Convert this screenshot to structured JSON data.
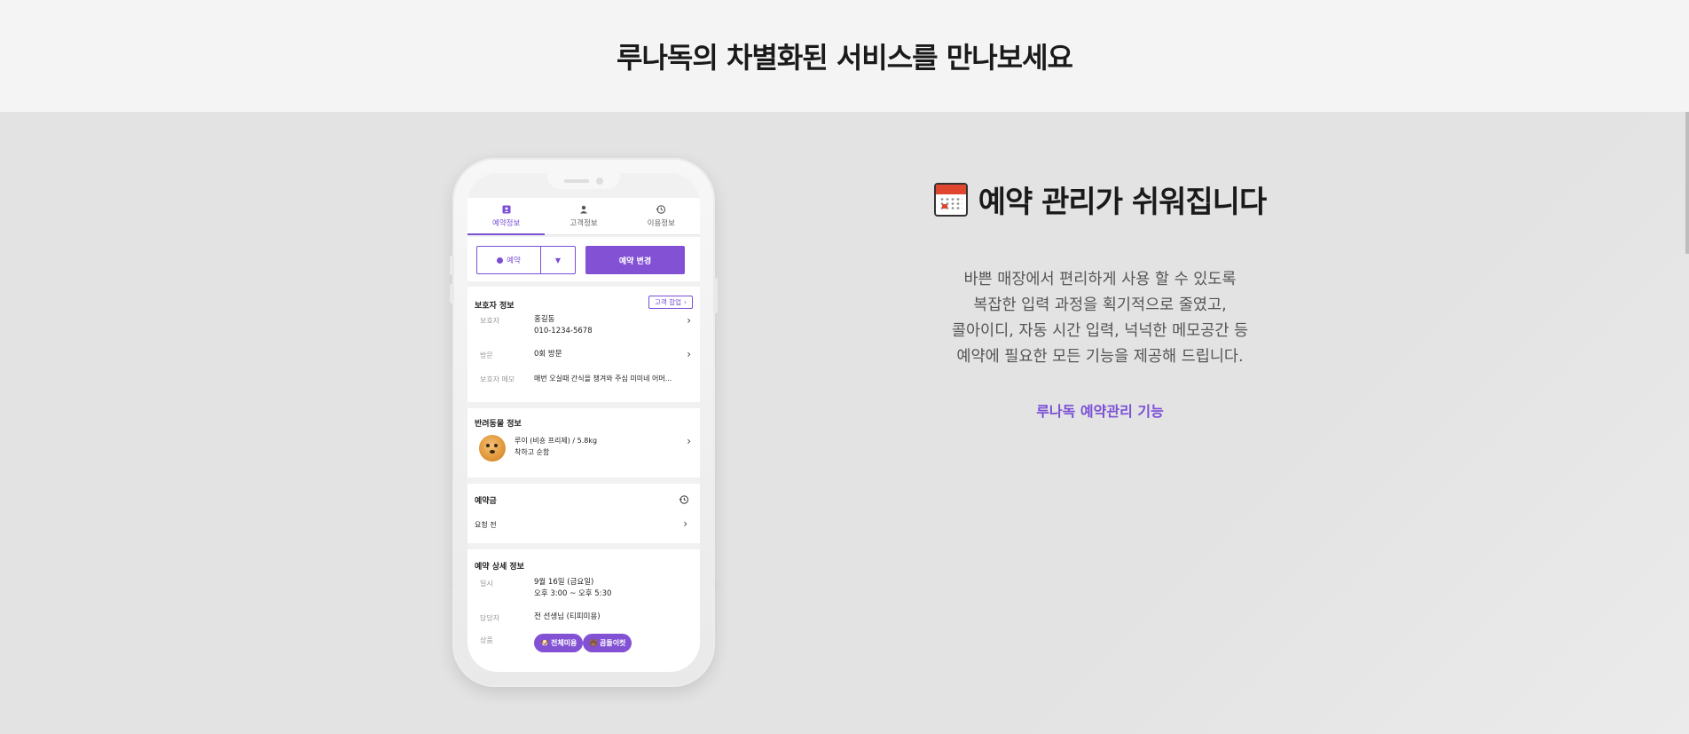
{
  "header": {
    "title": "루나독의 차별화된 서비스를 만나보세요"
  },
  "phone": {
    "tabs": [
      {
        "label": "예약정보",
        "icon": "calendar-person-icon",
        "active": true
      },
      {
        "label": "고객정보",
        "icon": "person-icon",
        "active": false
      },
      {
        "label": "이용정보",
        "icon": "history-icon",
        "active": false
      }
    ],
    "status_select": {
      "value": "예약"
    },
    "change_button": "예약 변경",
    "guardian": {
      "title": "보호자 정보",
      "merge_button": "고객 합업",
      "rows": [
        {
          "label": "보호자",
          "value": "홍길동",
          "value2": "010-1234-5678"
        },
        {
          "label": "방문",
          "value": "0회 방문"
        },
        {
          "label": "보호자 메모",
          "value": "매번 오실때 간식을 챙겨와 주심 미미네 어머..."
        }
      ]
    },
    "pet": {
      "title": "반려동물 정보",
      "line1": "루이 (비숑 프리제) / 5.8kg",
      "line2": "착하고 순함"
    },
    "deposit": {
      "title": "예약금",
      "status": "요청 전"
    },
    "detail": {
      "title": "예약 상세 정보",
      "rows": [
        {
          "label": "일시",
          "value": "9월 16일 (금요일)",
          "value2": "오후 3:00 ~ 오후 5:30"
        },
        {
          "label": "담당자",
          "value": "전 선생님 (티피미용)"
        },
        {
          "label": "상품",
          "pills": [
            "전체미용",
            "곰돌이컷"
          ]
        }
      ]
    }
  },
  "feature": {
    "icon": "calendar-icon",
    "title": "예약 관리가 쉬워집니다",
    "desc": [
      "바쁜 매장에서 편리하게 사용 할 수 있도록",
      "복잡한 입력 과정을 획기적으로 줄였고,",
      "콜아이디, 자동 시간 입력, 넉넉한 메모공간 등",
      "예약에 필요한 모든 기능을 제공해 드립니다."
    ],
    "link": "루나독 예약관리 기능"
  },
  "colors": {
    "accent": "#7a4fd6",
    "button": "#8352d4",
    "calendar_red": "#e0452f"
  }
}
